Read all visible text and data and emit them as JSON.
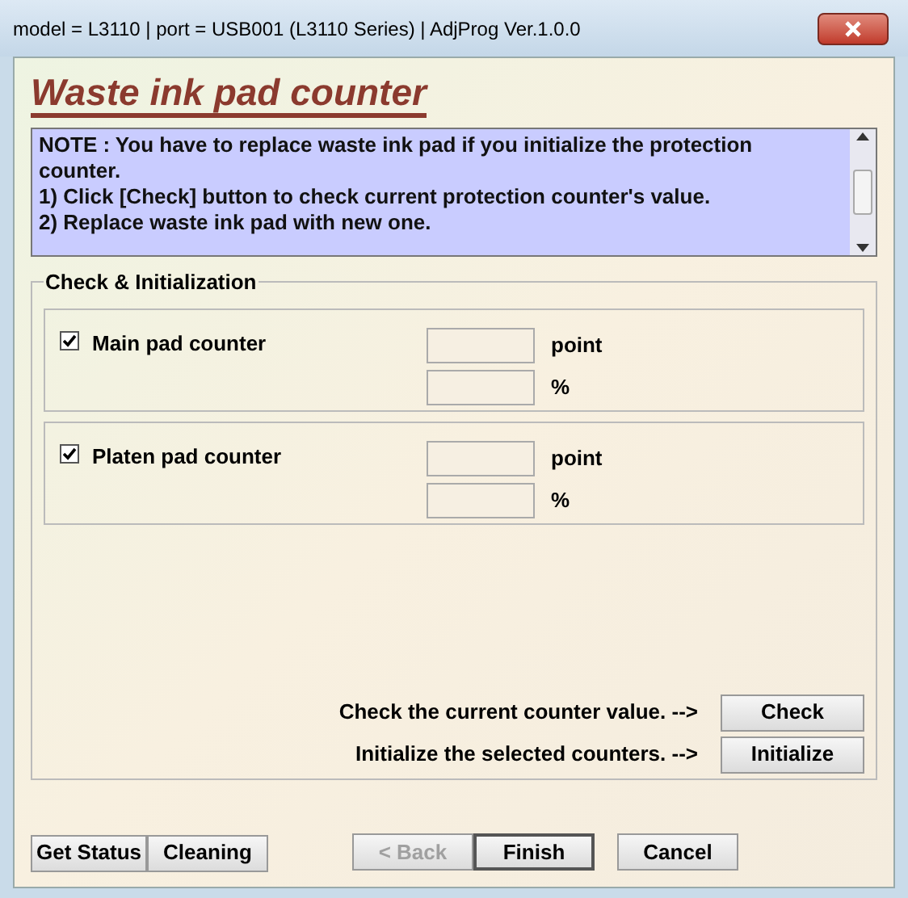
{
  "window": {
    "title": "model = L3110 | port = USB001 (L3110 Series) | AdjProg Ver.1.0.0"
  },
  "heading": "Waste ink pad counter",
  "note": [
    "NOTE : You have to replace waste ink pad if you initialize the protection counter.",
    "1) Click [Check] button to check current protection counter's value.",
    "2) Replace waste ink pad with new one."
  ],
  "group": {
    "title": "Check & Initialization"
  },
  "counters": [
    {
      "label": "Main pad counter",
      "checked": true,
      "units": [
        "point",
        "%"
      ]
    },
    {
      "label": "Platen pad counter",
      "checked": true,
      "units": [
        "point",
        "%"
      ]
    }
  ],
  "actions": [
    {
      "prompt": "Check the current counter value. -->",
      "button": "Check"
    },
    {
      "prompt": "Initialize the selected counters. -->",
      "button": "Initialize"
    }
  ],
  "footer_left": [
    {
      "label": "Get Status",
      "disabled": false,
      "default": false
    },
    {
      "label": "Cleaning",
      "disabled": false,
      "default": false
    }
  ],
  "footer_center": [
    {
      "label": "< Back",
      "disabled": true,
      "default": false
    },
    {
      "label": "Finish",
      "disabled": false,
      "default": true
    },
    {
      "label": "Cancel",
      "disabled": false,
      "default": false
    }
  ]
}
